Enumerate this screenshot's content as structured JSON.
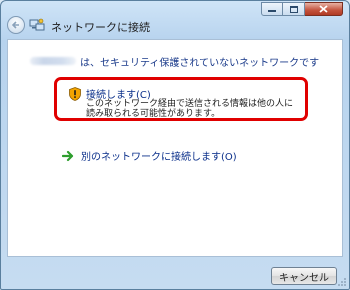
{
  "window": {
    "title": "ネットワークに接続"
  },
  "message": {
    "warning_suffix": "は、セキュリティ保護されていないネットワークです"
  },
  "option": {
    "title": "接続します(C)",
    "description": "このネットワーク経由で送信される情報は他の人に読み取られる可能性があります。"
  },
  "other_network": {
    "label": "別のネットワークに接続します(O)"
  },
  "footer": {
    "cancel_label": "キャンセル"
  },
  "colors": {
    "highlight_border": "#e00000",
    "link_text": "#0a2f8a",
    "arrow_green": "#2e9e2e"
  },
  "icons": {
    "back": "back-arrow-icon",
    "network": "network-icon",
    "shield": "shield-warning-icon",
    "arrow": "green-arrow-icon"
  }
}
